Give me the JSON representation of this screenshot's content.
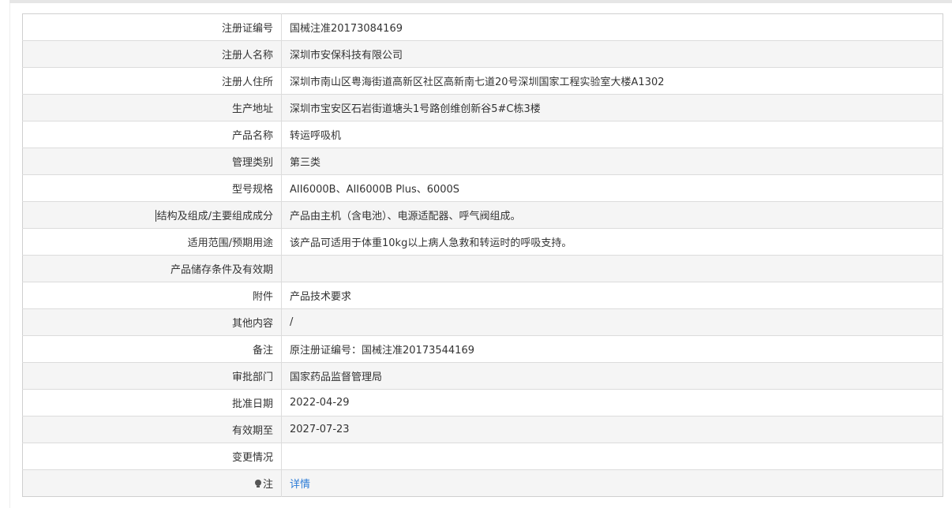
{
  "rows": [
    {
      "label": "注册证编号",
      "value": "国械注准20173084169"
    },
    {
      "label": "注册人名称",
      "value": "深圳市安保科技有限公司"
    },
    {
      "label": "注册人住所",
      "value": "深圳市南山区粤海街道高新区社区高新南七道20号深圳国家工程实验室大楼A1302"
    },
    {
      "label": "生产地址",
      "value": "深圳市宝安区石岩街道塘头1号路创维创新谷5#C栋3楼"
    },
    {
      "label": "产品名称",
      "value": "转运呼吸机"
    },
    {
      "label": "管理类别",
      "value": "第三类"
    },
    {
      "label": "型号规格",
      "value": "AII6000B、AII6000B Plus、6000S"
    },
    {
      "label": "结构及组成/主要组成成分",
      "value": "产品由主机（含电池）、电源适配器、呼气阀组成。"
    },
    {
      "label": "适用范围/预期用途",
      "value": "该产品可适用于体重10kg以上病人急救和转运时的呼吸支持。"
    },
    {
      "label": "产品储存条件及有效期",
      "value": ""
    },
    {
      "label": "附件",
      "value": "产品技术要求"
    },
    {
      "label": "其他内容",
      "value": "/"
    },
    {
      "label": "备注",
      "value": "原注册证编号：国械注准20173544169"
    },
    {
      "label": "审批部门",
      "value": "国家药品监督管理局"
    },
    {
      "label": "批准日期",
      "value": "2022-04-29"
    },
    {
      "label": "有效期至",
      "value": "2027-07-23"
    },
    {
      "label": "变更情况",
      "value": ""
    },
    {
      "label": "注",
      "value": "详情"
    }
  ],
  "icons": {
    "note_icon": "lightbulb-icon"
  },
  "colors": {
    "link": "#2b7bd6",
    "alt_row": "#f5f5f5",
    "border": "#dcdcdc"
  }
}
